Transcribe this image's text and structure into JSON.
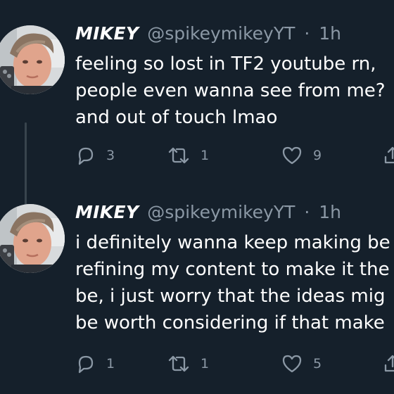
{
  "thread": {
    "tweets": [
      {
        "author_name": "MIKEY",
        "handle": "@spikeymikeyYT",
        "separator": "·",
        "time": "1h",
        "lines": [
          "feeling so lost in TF2 youtube rn,",
          "people even wanna see from me?",
          "and out of touch lmao"
        ],
        "reply_count": "3",
        "retweet_count": "1",
        "like_count": "9"
      },
      {
        "author_name": "MIKEY",
        "handle": "@spikeymikeyYT",
        "separator": "·",
        "time": "1h",
        "lines": [
          "i definitely wanna keep making be",
          "refining my content to make it the",
          "be, i just worry that the ideas mig",
          "be worth considering if that make"
        ],
        "reply_count": "1",
        "retweet_count": "1",
        "like_count": "5"
      }
    ]
  },
  "colors": {
    "background": "#15202b",
    "text": "#ffffff",
    "muted": "#8b98a5",
    "thread_line": "#38444d"
  },
  "icons": [
    "reply-icon",
    "retweet-icon",
    "like-icon",
    "share-icon"
  ]
}
